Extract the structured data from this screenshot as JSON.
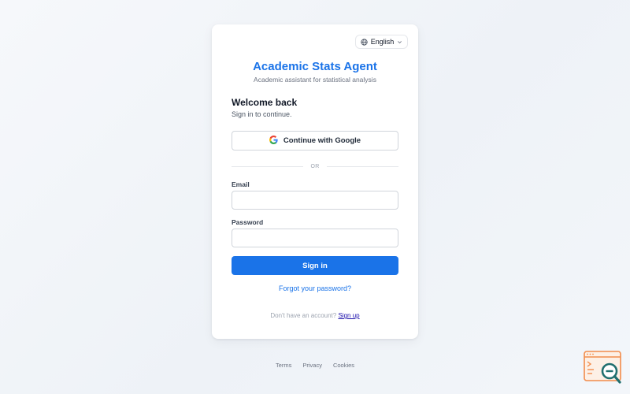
{
  "language": {
    "selected": "English"
  },
  "header": {
    "title": "Academic Stats Agent",
    "subtitle": "Academic assistant for statistical analysis"
  },
  "auth": {
    "heading": "Welcome back",
    "hint": "Sign in to continue.",
    "google_label": "Continue with Google",
    "divider": "OR",
    "email_label": "Email",
    "email_value": "",
    "email_placeholder": "",
    "password_label": "Password",
    "password_value": "",
    "password_placeholder": "",
    "submit_label": "Sign in",
    "forgot_label": "Forgot your password?",
    "no_account_text": "Don't have an account?",
    "signup_label": "Sign up"
  },
  "footer": {
    "links": [
      "Terms",
      "Privacy",
      "Cookies"
    ]
  },
  "colors": {
    "accent": "#1a73e8",
    "brand_orange": "#f28c4b",
    "brand_teal": "#1f6f6f"
  },
  "icons": {
    "language": "globe-icon",
    "dropdown": "chevron-down-icon",
    "google": "google-icon",
    "corner": "app-logo-icon"
  }
}
